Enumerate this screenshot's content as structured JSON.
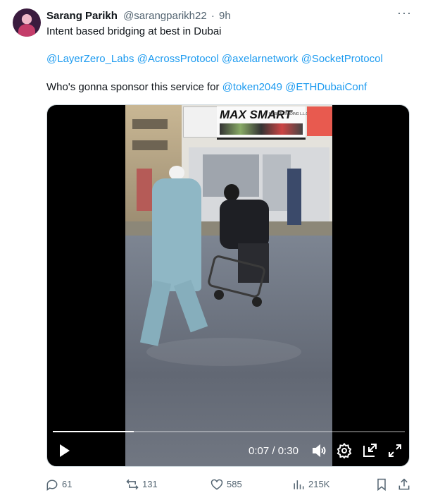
{
  "tweet": {
    "author_name": "Sarang Parikh",
    "author_handle": "@sarangparikh22",
    "separator": "·",
    "time_ago": "9h",
    "more_label": "···",
    "line1": "Intent based bridging at best in Dubai",
    "mentions": [
      "@LayerZero_Labs",
      "@AcrossProtocol",
      "@axelarnetwork",
      "@SocketProtocol"
    ],
    "line3_prefix": "Who's gonna sponsor this service for",
    "line3_mentions": [
      "@token2049",
      "@ETHDubaiConf"
    ]
  },
  "video": {
    "shop_sign_text": "MAX SMART",
    "shop_sub_text": "MOBILE TRADING L.L.C",
    "current_time": "0:07",
    "duration": "0:30",
    "time_separator": " / ",
    "progress": 0.23
  },
  "actions": {
    "replies": "61",
    "reposts": "131",
    "likes": "585",
    "views": "215K"
  },
  "colors": {
    "link": "#1d9bf0",
    "muted": "#536471",
    "text": "#0f1419"
  }
}
